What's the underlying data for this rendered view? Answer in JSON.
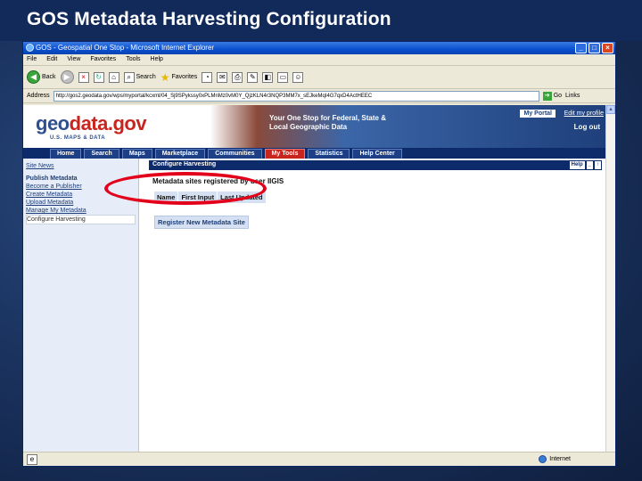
{
  "slide": {
    "title": "GOS Metadata Harvesting Configuration"
  },
  "browser": {
    "window_title": "GOS - Geospatial One Stop - Microsoft Internet Explorer",
    "menu": [
      "File",
      "Edit",
      "View",
      "Favorites",
      "Tools",
      "Help"
    ],
    "toolbar": {
      "back_label": "Back",
      "search_label": "Search",
      "favorites_label": "Favorites"
    },
    "address_label": "Address",
    "address_value": "http://gos2.geodata.gov/wps/myportal/kcxml/04_Sj9SPykssy0xPLMnMz0vM0Y_QjzKLN4r3NQP3MM7x_sEJkeMqI4G7qxD4ActHEEC",
    "go_label": "Go",
    "links_label": "Links",
    "status_zone": "Internet"
  },
  "site": {
    "logo_geo": "geo",
    "logo_data": "data.gov",
    "logo_sub": "U.S. MAPS & DATA",
    "tagline": "Your One Stop for Federal, State & Local Geographic Data",
    "my_portal": "My Portal",
    "edit_profile": "Edit my profile",
    "logout": "Log out",
    "tabs": [
      "Home",
      "Search",
      "Maps",
      "Marketplace",
      "Communities",
      "My Tools",
      "Statistics",
      "Help Center"
    ],
    "active_tab": "My Tools"
  },
  "leftnav": {
    "site_news": "Site News",
    "publish_heading": "Publish Metadata",
    "items": [
      "Become a Publisher",
      "Create Metadata",
      "Upload Metadata",
      "Manage My Metadata",
      "Configure Harvesting"
    ]
  },
  "content": {
    "panel_title": "Configure Harvesting",
    "panel_help": "Help",
    "panel_min": "_",
    "panel_max": "↑",
    "registered_text": "Metadata sites registered by user IIGIS",
    "columns": [
      "Name",
      "First Input",
      "Last Updated"
    ],
    "register_button": "Register New Metadata Site"
  },
  "colors": {
    "accent": "#0d2b6b",
    "highlight_ring": "#e3001b",
    "brand_red": "#c8251f"
  }
}
